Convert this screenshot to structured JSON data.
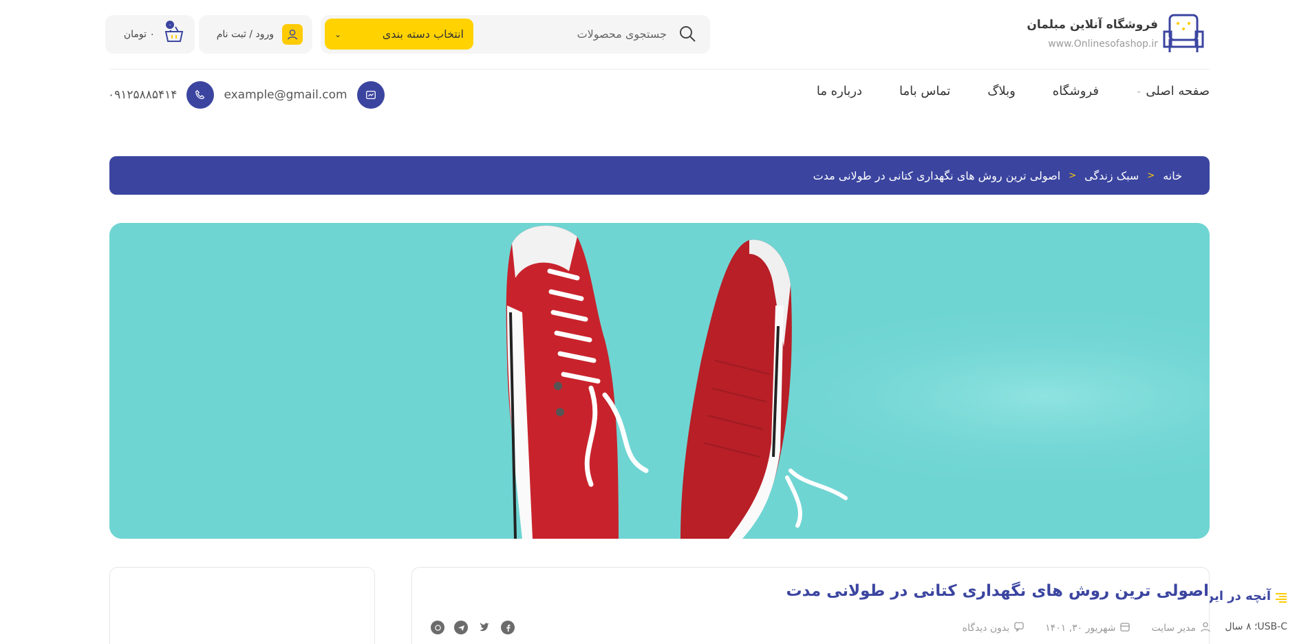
{
  "brand": {
    "title": "فروشگاه آنلاین مبلمان",
    "url": "www.Onlinesofashop.ir",
    "logo_icon": "sofa-icon"
  },
  "search": {
    "placeholder": "جستجوی محصولات",
    "icon": "search-icon",
    "category_label": "انتخاب دسته بندی"
  },
  "account": {
    "login_label": "ورود / ثبت نام",
    "icon": "user-icon"
  },
  "cart": {
    "total": "۰ تومان",
    "badge": "۰",
    "icon": "basket-icon"
  },
  "nav": {
    "items": [
      {
        "label": "صفحه اصلی",
        "has_submenu": true
      },
      {
        "label": "فروشگاه"
      },
      {
        "label": "وبلاگ"
      },
      {
        "label": "تماس باما"
      },
      {
        "label": "درباره ما"
      }
    ]
  },
  "contact": {
    "email": "example@gmail.com",
    "phone": "۰۹۱۲۵۸۸۵۴۱۴"
  },
  "breadcrumb": {
    "items": [
      "خانه",
      "سبک زندگی",
      "اصولی ترین روش های نگهداری کتانی در طولانی مدت"
    ]
  },
  "sidebar": {
    "toc_title": "آنچه در این مقاله میخوانیم",
    "toc_items": [
      "USB-C؛ ۸ سال"
    ]
  },
  "article": {
    "title": "اصولی ترین روش های نگهداری کتانی در طولانی مدت",
    "author": "مدیر سایت",
    "date": "شهریور ۳۰, ۱۴۰۱",
    "comments": "بدون دیدگاه",
    "share": [
      "facebook-icon",
      "twitter-icon",
      "telegram-icon",
      "whatsapp-icon"
    ]
  },
  "colors": {
    "primary": "#3b45a0",
    "accent": "#ffd200",
    "hero_bg": "#6fd5d3",
    "shoe_red": "#c8232c"
  }
}
